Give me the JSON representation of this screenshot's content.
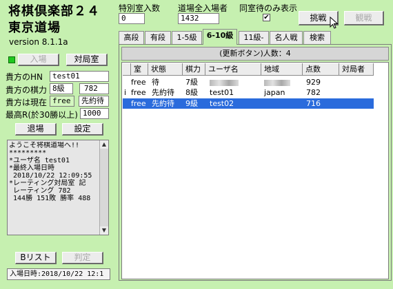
{
  "app": {
    "title_line1": "将棋倶楽部２４",
    "title_line2": "東京道場",
    "version": "version 8.1.1a"
  },
  "top": {
    "special_label": "特別室入数",
    "special_value": "0",
    "dojo_label": "道場全入場者",
    "dojo_value": "1432",
    "same_room_label": "同室待のみ表示",
    "same_room_checked": "✔",
    "challenge_button": "挑戦",
    "spectate_button": "観戦"
  },
  "left": {
    "enter_button": "入場",
    "room_button": "対局室",
    "hn_label": "貴方のHN",
    "hn_value": "test01",
    "rating_label": "貴方の棋力",
    "rank_value": "8級",
    "rating_value": "782",
    "status_label": "貴方は現在",
    "status_value": "free",
    "status_mode": "先約待",
    "max_label": "最高R(於30勝以上)",
    "max_value": "1000",
    "exit_button": "退場",
    "settings_button": "設定",
    "log_lines": "ようこそ将棋道場へ!!\n*********\n*ユーザ名 test01\n*最終入場日時\n 2018/10/22 12:09:55\n*レーティング対局室 記\n レーティング 782\n 144勝 151敗 勝率 488",
    "blist_button": "Bリスト",
    "judge_button": "判定",
    "entry_time": "入場日時:2018/10/22 12:1"
  },
  "tabs": [
    "高段",
    "有段",
    "1-5級",
    "6-10級",
    "11級-",
    "名人戦",
    "検索"
  ],
  "panel": {
    "header": "(更新ボタン)人数：4",
    "columns": [
      "",
      "室",
      "状態",
      "棋力",
      "ユーザ名",
      "地域",
      "点数",
      "対局者"
    ],
    "rows": [
      {
        "mark": "",
        "room": "free",
        "state": "待",
        "rank": "7級",
        "user": "",
        "region": "",
        "score": "929",
        "opponent": ""
      },
      {
        "mark": "i",
        "room": "free",
        "state": "先約待",
        "rank": "8級",
        "user": "test01",
        "region": "japan",
        "score": "782",
        "opponent": ""
      },
      {
        "mark": "",
        "room": "free",
        "state": "先約待",
        "rank": "9級",
        "user": "test02",
        "region": "",
        "score": "716",
        "opponent": ""
      }
    ]
  },
  "colors": {
    "background": "#c6f0b0",
    "selection": "#2a6bdc",
    "led": "#1fc81f"
  },
  "icons": {
    "led": "status-led-icon",
    "cursor": "mouse-pointer-icon"
  }
}
